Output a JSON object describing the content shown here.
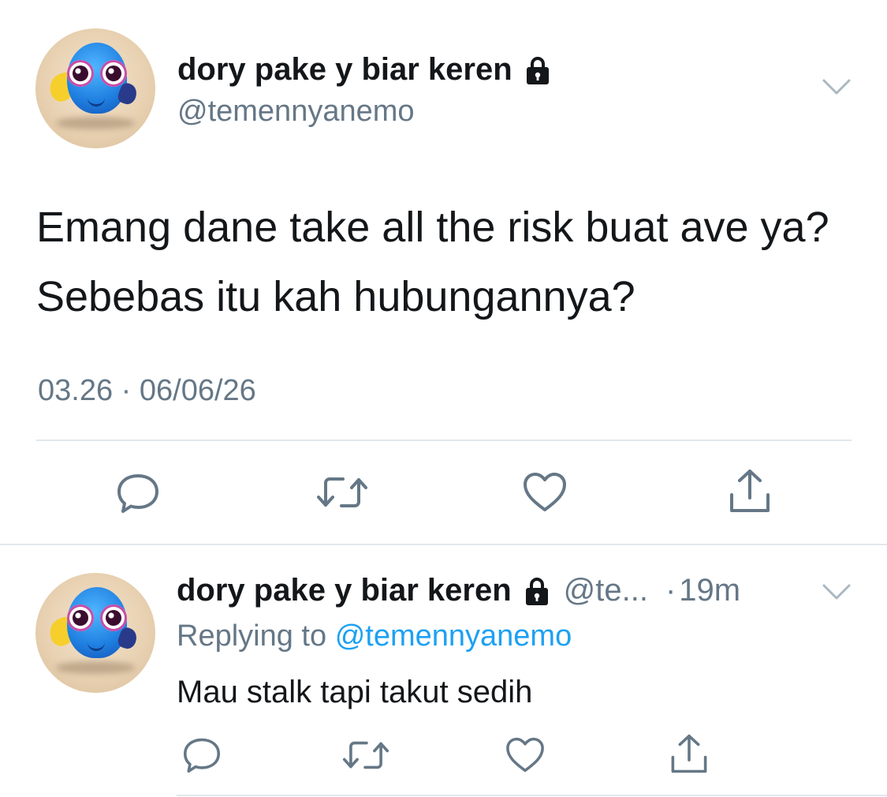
{
  "main_tweet": {
    "display_name": "dory pake y biar keren",
    "handle": "@temennyanemo",
    "text": "Emang dane take all the risk buat ave ya? Sebebas itu kah hubungannya?",
    "timestamp": "03.26 · 06/06/26",
    "icons": {
      "lock": "lock-icon",
      "menu": "chevron-down-icon",
      "reply": "reply-icon",
      "retweet": "retweet-icon",
      "like": "heart-icon",
      "share": "share-icon"
    }
  },
  "reply_tweet": {
    "display_name": "dory pake y biar keren",
    "handle": "@te...",
    "separator": "·",
    "time": "19m",
    "replying_prefix": "Replying to",
    "replying_handle": "@temennyanemo",
    "text": "Mau stalk tapi takut sedih"
  },
  "colors": {
    "text_primary": "#14171a",
    "text_secondary": "#657786",
    "link": "#1da1f2",
    "divider": "#e1e8ed",
    "icon": "#657786"
  }
}
